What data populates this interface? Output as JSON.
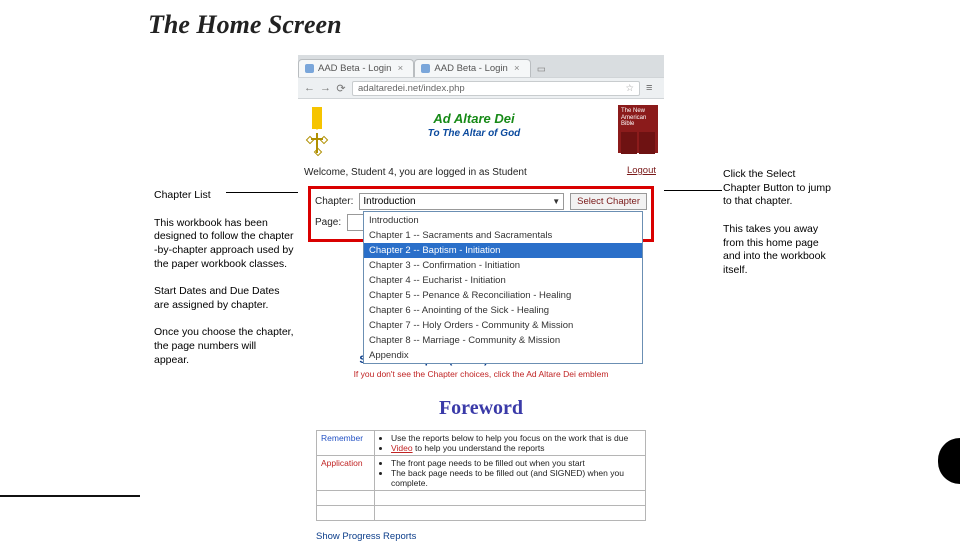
{
  "slide": {
    "title": "The Home Screen"
  },
  "leftNotes": {
    "heading": "Chapter List",
    "p1": "This workbook has been designed to follow the chapter -by-chapter approach used by the paper workbook classes.",
    "p2": "Start Dates and Due Dates are assigned by chapter.",
    "p3": "Once you choose the chapter, the page numbers will appear."
  },
  "rightNotes": {
    "p1": "Click the Select Chapter Button to jump to that chapter.",
    "p2": "This takes you away from this home page and into the workbook itself."
  },
  "browser": {
    "tabs": [
      {
        "label": "AAD Beta - Login"
      },
      {
        "label": "AAD Beta - Login"
      }
    ],
    "url": "adaltaredei.net/index.php"
  },
  "site": {
    "title": "Ad Altare Dei",
    "subtitle": "To The Altar of God",
    "bibleLabel": "The New American Bible",
    "welcome": "Welcome, Student 4, you are logged in as Student",
    "logout": "Logout"
  },
  "selector": {
    "chapterLabel": "Chapter:",
    "selected": "Introduction",
    "pageLabel": "Page:",
    "button": "Select Chapter",
    "options": [
      "Introduction",
      "Chapter 1 -- Sacraments and Sacramentals",
      "Chapter 2 -- Baptism - Initiation",
      "Chapter 3 -- Confirmation - Initiation",
      "Chapter 4 -- Eucharist - Initiation",
      "Chapter 5 -- Penance & Reconciliation - Healing",
      "Chapter 6 -- Anointing of the Sick - Healing",
      "Chapter 7 -- Holy Orders - Community & Mission",
      "Chapter 8 -- Marriage - Community & Mission",
      "Appendix"
    ],
    "highlightIndex": 2
  },
  "instructions": {
    "main": "Select a Chapter (above) to view the workbook",
    "sub": "If you don't see the Chapter choices, click the Ad Altare Dei emblem"
  },
  "foreword": {
    "heading": "Foreword",
    "rows": [
      {
        "label": "Remember",
        "bullets": [
          "Use the reports below to help you focus on the work that is due",
          "Video to help you understand the reports"
        ],
        "videoText": "Video"
      },
      {
        "label": "Application",
        "bullets": [
          "The front page needs to be filled out when you start",
          "The back page needs to be filled out (and SIGNED) when you complete."
        ]
      }
    ]
  },
  "links": {
    "showReports": "Show Progress Reports"
  }
}
